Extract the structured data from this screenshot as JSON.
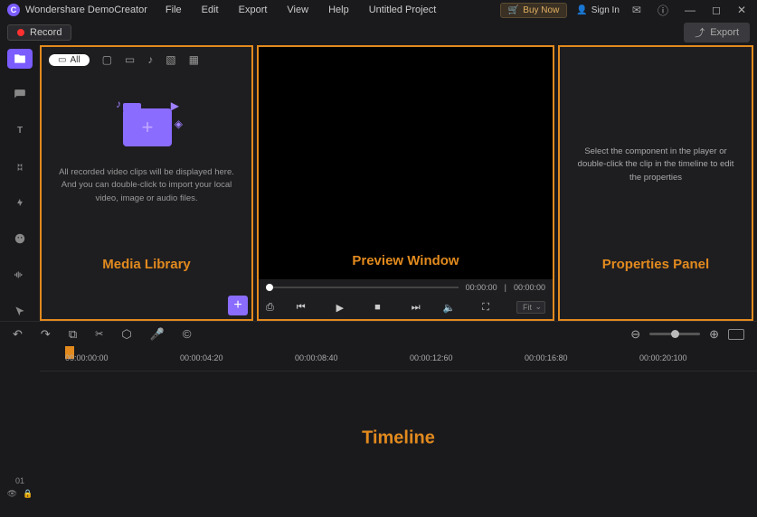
{
  "app": {
    "title": "Wondershare DemoCreator",
    "project": "Untitled Project"
  },
  "menu": [
    "File",
    "Edit",
    "Export",
    "View",
    "Help"
  ],
  "titlebar": {
    "buy_now": "Buy Now",
    "sign_in": "Sign In"
  },
  "toolbar": {
    "record": "Record",
    "export": "Export"
  },
  "media": {
    "all_label": "All",
    "hint": "All recorded video clips will be displayed here. And you can double-click to import your local video, image or audio files.",
    "panel_label": "Media Library"
  },
  "preview": {
    "time_current": "00:00:00",
    "time_total": "00:00:00",
    "fit": "Fit",
    "panel_label": "Preview Window"
  },
  "properties": {
    "hint": "Select the component in the player or double-click the clip in the timeline to edit the properties",
    "panel_label": "Properties Panel"
  },
  "timeline": {
    "ticks": [
      "00:00:00:00",
      "00:00:04:20",
      "00:00:08:40",
      "00:00:12:60",
      "00:00:16:80",
      "00:00:20:100"
    ],
    "track": "01",
    "panel_label": "Timeline"
  }
}
